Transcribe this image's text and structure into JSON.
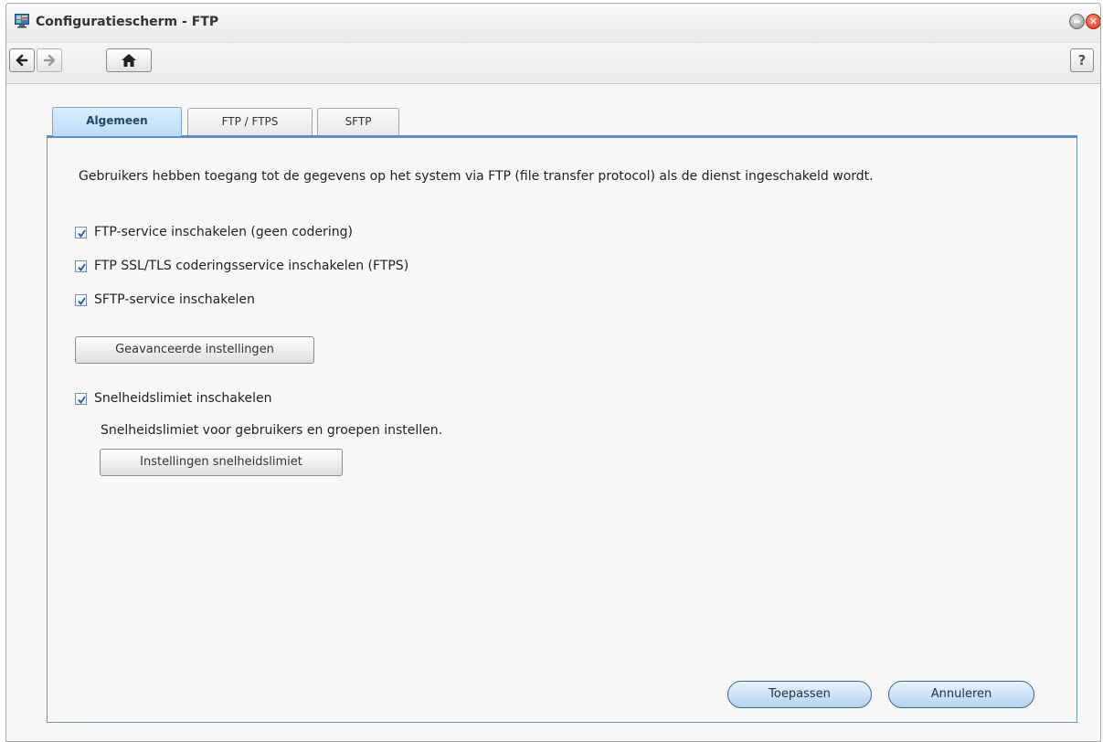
{
  "window": {
    "title": "Configuratiescherm - FTP"
  },
  "titlebar_buttons": {
    "minimize_icon": "minimize-icon",
    "close_icon": "close-icon",
    "close_glyph": "✕"
  },
  "toolbar": {
    "back_icon": "arrow-left-icon",
    "forward_icon": "arrow-right-icon",
    "home_icon": "home-icon",
    "help_label": "?"
  },
  "tabs": [
    {
      "label": "Algemeen",
      "active": true
    },
    {
      "label": "FTP / FTPS",
      "active": false
    },
    {
      "label": "SFTP",
      "active": false
    }
  ],
  "general": {
    "intro": "Gebruikers hebben toegang tot de gegevens op het system via FTP (file transfer protocol) als de dienst ingeschakeld wordt.",
    "checkboxes": [
      {
        "label": "FTP-service inschakelen (geen codering)",
        "checked": true
      },
      {
        "label": "FTP SSL/TLS coderingsservice inschakelen (FTPS)",
        "checked": true
      },
      {
        "label": "SFTP-service inschakelen",
        "checked": true
      }
    ],
    "advanced_button": "Geavanceerde instellingen",
    "speed_limit": {
      "label": "Snelheidslimiet inschakelen",
      "checked": true,
      "description": "Snelheidslimiet voor gebruikers en groepen instellen.",
      "button": "Instellingen snelheidslimiet"
    }
  },
  "footer": {
    "apply": "Toepassen",
    "cancel": "Annuleren"
  },
  "colors": {
    "accent": "#5c8ec1",
    "active_tab": "#bcdcf7",
    "close": "#d6301c"
  }
}
